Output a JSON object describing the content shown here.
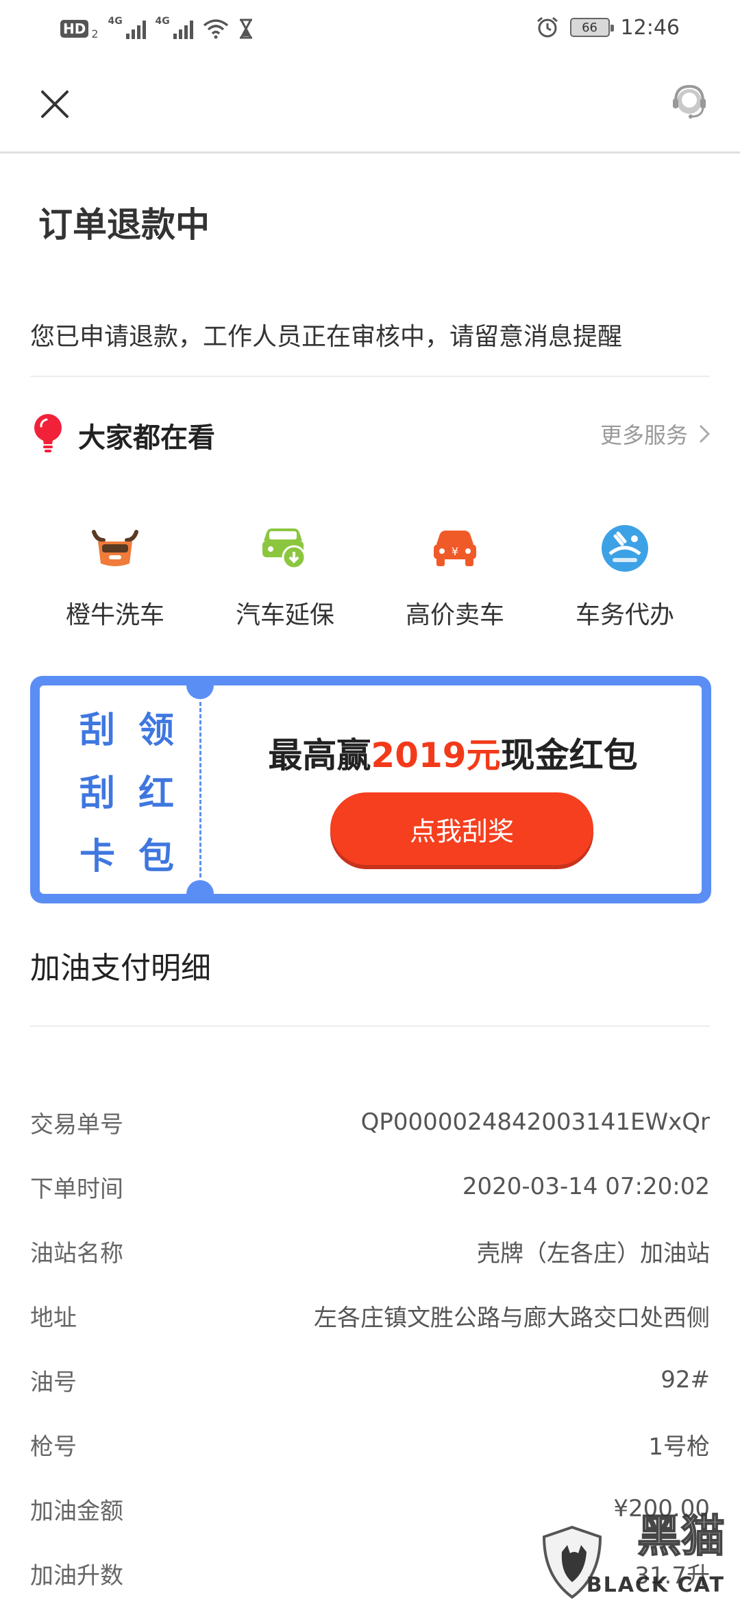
{
  "status_bar": {
    "hd_badge": "HD",
    "hd_sub": "2",
    "sim1_tag": "4G",
    "sim2_tag": "4G",
    "battery": "66",
    "time": "12:46",
    "icons": [
      "wifi-icon",
      "hourglass-icon",
      "alarm-icon"
    ]
  },
  "header": {
    "close_icon": "close-icon",
    "support_icon": "customer-service-icon"
  },
  "order": {
    "status_title": "订单退款中",
    "status_message": "您已申请退款，工作人员正在审核中，请留意消息提醒"
  },
  "recommend": {
    "title": "大家都在看",
    "more_label": "更多服务",
    "services": [
      {
        "label": "橙牛洗车",
        "icon": "car-wash-icon",
        "color": "#f07b3a"
      },
      {
        "label": "汽车延保",
        "icon": "car-warranty-icon",
        "color": "#8cc63f"
      },
      {
        "label": "高价卖车",
        "icon": "sell-car-icon",
        "color": "#f05a28"
      },
      {
        "label": "车务代办",
        "icon": "car-agent-icon",
        "color": "#3da1e6"
      }
    ]
  },
  "promo": {
    "scratch_words": [
      "刮",
      "领",
      "刮",
      "红",
      "卡",
      "包"
    ],
    "prize_prefix": "最高赢",
    "prize_amount": "2019元",
    "prize_suffix": "现金红包",
    "button_label": "点我刮奖",
    "accent": "#5b8ef5",
    "button_color": "#f53f1f"
  },
  "payment": {
    "title": "加油支付明细",
    "rows": [
      {
        "label": "交易单号",
        "value": "QP0000024842003141EWxQr"
      },
      {
        "label": "下单时间",
        "value": "2020-03-14 07:20:02"
      },
      {
        "label": "油站名称",
        "value": "壳牌（左各庄）加油站"
      },
      {
        "label": "地址",
        "value": "左各庄镇文胜公路与廊大路交口处西侧"
      },
      {
        "label": "油号",
        "value": "92#"
      },
      {
        "label": "枪号",
        "value": "1号枪"
      },
      {
        "label": "加油金额",
        "value": "¥200.00"
      },
      {
        "label": "加油升数",
        "value": "31.7升"
      }
    ]
  },
  "watermark": {
    "text": "黑猫",
    "sub": "BLACK CAT"
  }
}
